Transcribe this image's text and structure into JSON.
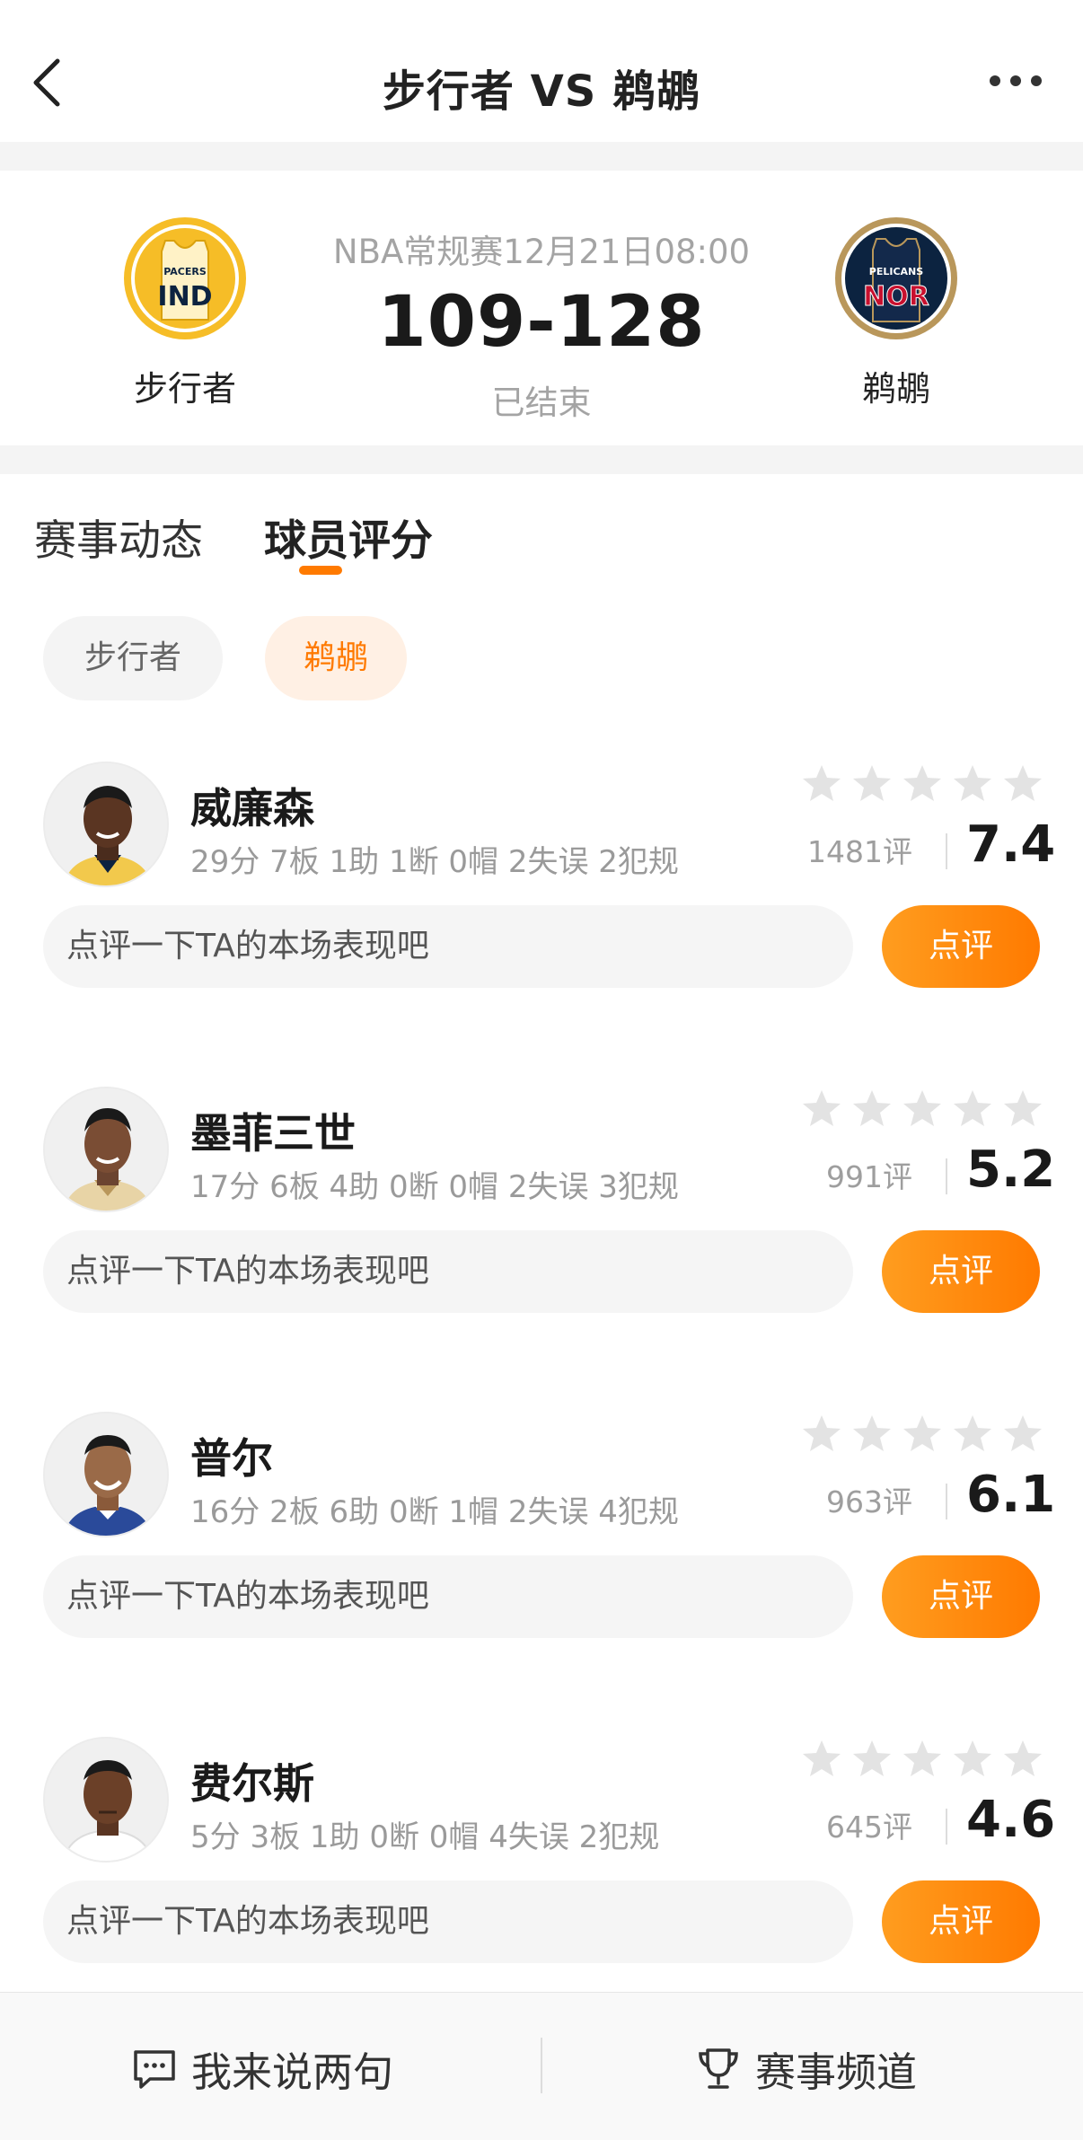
{
  "nav": {
    "title": "步行者 VS 鹈鹕",
    "back_icon": "chevron-left-icon",
    "more_icon": "more-dots-icon"
  },
  "match": {
    "info": "NBA常规赛12月21日08:00",
    "score": "109-128",
    "status": "已结束",
    "home": {
      "name": "步行者",
      "logo_text_top": "PACERS",
      "logo_text_main": "IND",
      "color": "#f6bd27"
    },
    "away": {
      "name": "鹈鹕",
      "logo_text_top": "PELICANS",
      "logo_text_main": "NOR",
      "color": "#0c2340"
    }
  },
  "tabs": [
    {
      "label": "赛事动态",
      "active": false
    },
    {
      "label": "球员评分",
      "active": true
    }
  ],
  "filters": [
    {
      "label": "步行者",
      "active": false
    },
    {
      "label": "鹈鹕",
      "active": true
    }
  ],
  "players": [
    {
      "name": "威廉森",
      "stats": "29分 7板 1助 1断 0帽 2失误 2犯规",
      "reviews": "1481评",
      "score": "7.4",
      "comment_placeholder": "点评一下TA的本场表现吧",
      "comment_button": "点评"
    },
    {
      "name": "墨菲三世",
      "stats": "17分 6板 4助 0断 0帽 2失误 3犯规",
      "reviews": "991评",
      "score": "5.2",
      "comment_placeholder": "点评一下TA的本场表现吧",
      "comment_button": "点评"
    },
    {
      "name": "普尔",
      "stats": "16分 2板 6助 0断 1帽 2失误 4犯规",
      "reviews": "963评",
      "score": "6.1",
      "comment_placeholder": "点评一下TA的本场表现吧",
      "comment_button": "点评"
    },
    {
      "name": "费尔斯",
      "stats": "5分 3板 1助 0断 0帽 4失误 2犯规",
      "reviews": "645评",
      "score": "4.6",
      "comment_placeholder": "点评一下TA的本场表现吧",
      "comment_button": "点评"
    }
  ],
  "bottom_bar": {
    "chat_label": "我来说两句",
    "chat_icon": "chat-bubble-icon",
    "channel_label": "赛事频道",
    "channel_icon": "trophy-icon"
  },
  "colors": {
    "accent": "#ff7a00",
    "accent_light": "#fff0e4",
    "star_empty": "#e3e3e3",
    "text_muted": "#9a9a9a"
  }
}
